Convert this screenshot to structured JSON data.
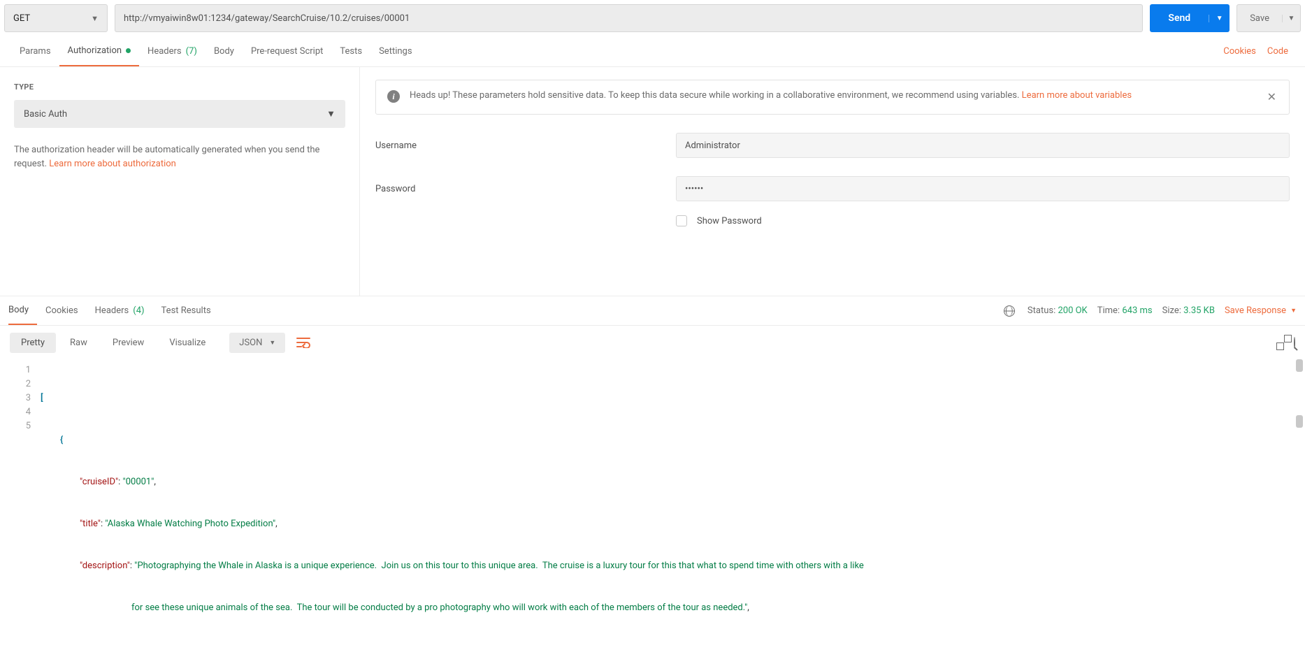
{
  "request": {
    "method": "GET",
    "url": "http://vmyaiwin8w01:1234/gateway/SearchCruise/10.2/cruises/00001",
    "send_label": "Send",
    "save_label": "Save"
  },
  "req_tabs": {
    "params": "Params",
    "authorization": "Authorization",
    "headers": "Headers",
    "headers_count": "(7)",
    "body": "Body",
    "prerequest": "Pre-request Script",
    "tests": "Tests",
    "settings": "Settings",
    "cookies": "Cookies",
    "code": "Code"
  },
  "auth": {
    "type_label": "TYPE",
    "type_value": "Basic Auth",
    "note_prefix": "The authorization header will be automatically generated when you send the request. ",
    "note_link": "Learn more about authorization",
    "alert_bold": "Heads up!",
    "alert_text": " These parameters hold sensitive data. To keep this data secure while working in a collaborative environment, we recommend using variables. ",
    "alert_link": "Learn more about variables",
    "username_label": "Username",
    "username_value": "Administrator",
    "password_label": "Password",
    "password_value": "••••••",
    "show_password": "Show Password"
  },
  "resp_tabs": {
    "body": "Body",
    "cookies": "Cookies",
    "headers": "Headers",
    "headers_count": "(4)",
    "test_results": "Test Results"
  },
  "resp_meta": {
    "status_label": "Status:",
    "status_value": "200 OK",
    "time_label": "Time:",
    "time_value": "643 ms",
    "size_label": "Size:",
    "size_value": "3.35 KB",
    "save_response": "Save Response"
  },
  "resp_tools": {
    "pretty": "Pretty",
    "raw": "Raw",
    "preview": "Preview",
    "visualize": "Visualize",
    "format": "JSON"
  },
  "response_json": {
    "line1": "[",
    "line2": "{",
    "k_cruiseID": "\"cruiseID\"",
    "v_cruiseID": "\"00001\"",
    "k_title": "\"title\"",
    "v_title": "\"Alaska Whale Watching Photo Expedition\"",
    "k_description": "\"description\"",
    "v_desc_a": "\"Photographying the Whale in Alaska is a unique experience.  Join us on this tour to this unique area.  The cruise is a luxury tour for this that what to spend time with others with a like",
    "v_desc_b": "for see these unique animals of the sea.  The tour will be conducted by a pro photography who will work with each of the members of the tour as needed.\""
  }
}
